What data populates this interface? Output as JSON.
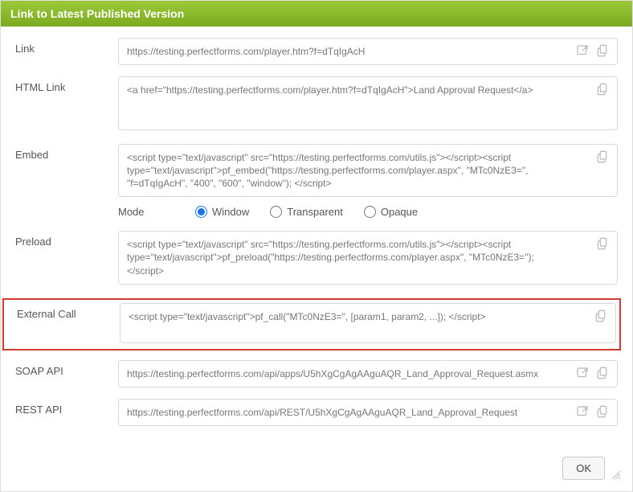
{
  "header": {
    "title": "Link to Latest Published Version"
  },
  "labels": {
    "link": "Link",
    "html_link": "HTML Link",
    "embed": "Embed",
    "preload": "Preload",
    "external_call": "External Call",
    "soap_api": "SOAP API",
    "rest_api": "REST API",
    "mode": "Mode"
  },
  "fields": {
    "link": "https://testing.perfectforms.com/player.htm?f=dTqIgAcH",
    "html_link": "<a href=\"https://testing.perfectforms.com/player.htm?f=dTqIgAcH\">Land Approval Request</a>",
    "embed": "<script type=\"text/javascript\" src=\"https://testing.perfectforms.com/utils.js\"></script><script type=\"text/javascript\">pf_embed(\"https://testing.perfectforms.com/player.aspx\", \"MTc0NzE3=\", \"f=dTqIgAcH\", \"400\", \"600\", \"window\"); </script>",
    "preload": "<script type=\"text/javascript\" src=\"https://testing.perfectforms.com/utils.js\"></script><script type=\"text/javascript\">pf_preload(\"https://testing.perfectforms.com/player.aspx\", \"MTc0NzE3=\"); </script>",
    "external_call": "<script type=\"text/javascript\">pf_call(\"MTc0NzE3=\", [param1, param2, ...]); </script>",
    "soap_api": "https://testing.perfectforms.com/api/apps/U5hXgCgAgAAguAQR_Land_Approval_Request.asmx",
    "rest_api": "https://testing.perfectforms.com/api/REST/U5hXgCgAgAAguAQR_Land_Approval_Request"
  },
  "mode": {
    "options": {
      "window": "Window",
      "transparent": "Transparent",
      "opaque": "Opaque"
    },
    "selected": "window"
  },
  "footer": {
    "ok": "OK"
  }
}
